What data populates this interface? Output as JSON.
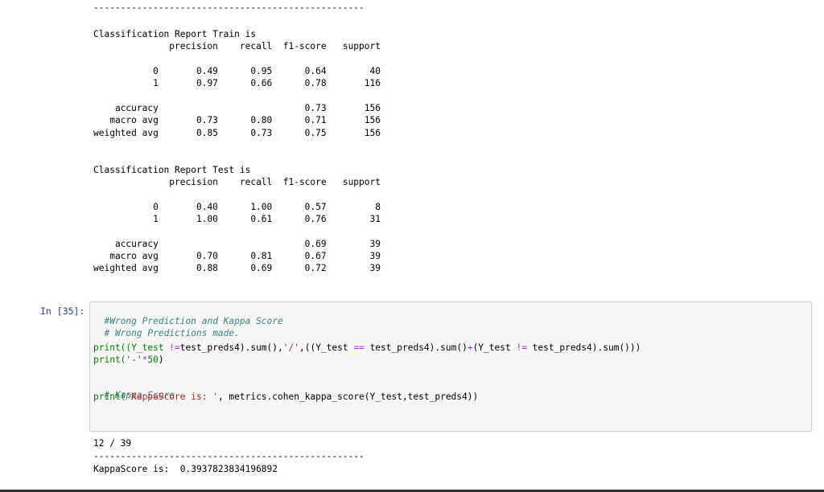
{
  "top_dashes": "--------------------------------------------------",
  "train": {
    "title": "Classification Report Train is",
    "header": "              precision    recall  f1-score   support",
    "rows": [
      "           0       0.49      0.95      0.64        40",
      "           1       0.97      0.66      0.78       116",
      "",
      "    accuracy                           0.73       156",
      "   macro avg       0.73      0.80      0.71       156",
      "weighted avg       0.85      0.73      0.75       156"
    ]
  },
  "test": {
    "title": "Classification Report Test is",
    "header": "              precision    recall  f1-score   support",
    "rows": [
      "           0       0.40      1.00      0.57         8",
      "           1       1.00      0.61      0.76        31",
      "",
      "    accuracy                           0.69        39",
      "   macro avg       0.70      0.81      0.67        39",
      "weighted avg       0.88      0.69      0.72        39"
    ]
  },
  "cell": {
    "prompt": "In [35]:",
    "comment1": "#Wrong Prediction and Kappa Score",
    "comment2": "# Wrong Predictions made.",
    "line3_a": "print((Y_test ",
    "line3_op1": "!=",
    "line3_b": "test_preds4).sum(),",
    "line3_str": "'/'",
    "line3_c": ",((Y_test ",
    "line3_op2": "==",
    "line3_d": " test_preds4).sum()",
    "line3_op3": "+",
    "line3_e": "(Y_test ",
    "line3_op4": "!=",
    "line3_f": " test_preds4).sum()))",
    "line4_a": "print(",
    "line4_str": "'-'",
    "line4_op": "*",
    "line4_num": "50",
    "line4_b": ")",
    "comment3": "# Kappa Score",
    "line6_a": "print(",
    "line6_str": "'KappaScore is: '",
    "line6_b": ", metrics.cohen_kappa_score(Y_test,test_preds4))"
  },
  "output": {
    "line1": "12 / 39",
    "dashes": "--------------------------------------------------",
    "line3": "KappaScore is:  0.3937823834196892"
  }
}
